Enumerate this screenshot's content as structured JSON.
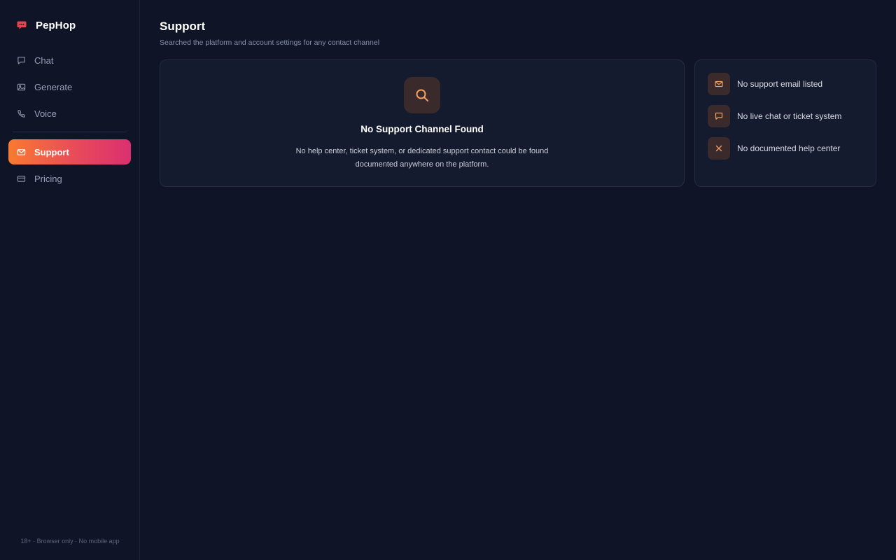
{
  "brand": {
    "name": "PepHop",
    "logo_icon": "speech-bubble-logo-icon"
  },
  "sidebar": {
    "items": [
      {
        "label": "Chat",
        "icon": "chat-icon",
        "active": false
      },
      {
        "label": "Generate",
        "icon": "image-icon",
        "active": false
      },
      {
        "label": "Voice",
        "icon": "phone-icon",
        "active": false
      },
      {
        "label": "Support",
        "icon": "mail-icon",
        "active": true
      },
      {
        "label": "Pricing",
        "icon": "card-icon",
        "active": false
      }
    ],
    "footer": "18+ · Browser only · No mobile app"
  },
  "page": {
    "title": "Support",
    "subtitle": "Searched the platform and account settings for any contact channel"
  },
  "empty_state": {
    "icon": "search-icon",
    "heading": "No Support Channel Found",
    "description": "No help center, ticket system, or dedicated support contact could be found documented anywhere on the platform."
  },
  "findings": [
    {
      "icon": "mail-icon",
      "text": "No support email listed"
    },
    {
      "icon": "chat-icon",
      "text": "No live chat or ticket system"
    },
    {
      "icon": "close-icon",
      "text": "No documented help center"
    }
  ],
  "colors": {
    "background": "#0f1426",
    "card": "#151b2e",
    "accent_start": "#f97a2f",
    "accent_end": "#db2f70",
    "icon_orange": "#f0a060"
  }
}
